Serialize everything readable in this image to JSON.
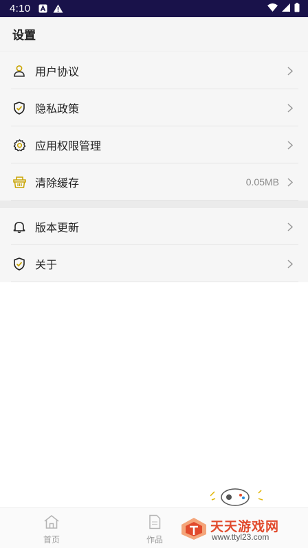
{
  "status_bar": {
    "time": "4:10",
    "icons": [
      "a-notification-icon",
      "warning-icon",
      "wifi-icon",
      "cellular-icon",
      "battery-icon"
    ]
  },
  "header": {
    "title": "设置"
  },
  "settings": {
    "group1": [
      {
        "label": "用户协议",
        "icon": "user-icon"
      },
      {
        "label": "隐私政策",
        "icon": "shield-check-icon"
      },
      {
        "label": "应用权限管理",
        "icon": "gear-icon"
      },
      {
        "label": "清除缓存",
        "icon": "basket-icon",
        "value": "0.05MB"
      }
    ],
    "group2": [
      {
        "label": "版本更新",
        "icon": "bell-icon"
      },
      {
        "label": "关于",
        "icon": "shield-check-icon"
      }
    ]
  },
  "bottom_nav": {
    "items": [
      {
        "label": "首页",
        "icon": "home-icon"
      },
      {
        "label": "作品",
        "icon": "document-gif-icon"
      }
    ]
  },
  "watermark": {
    "brand": "天天游戏网",
    "url": "www.ttyl23.com"
  },
  "colors": {
    "status_bar_bg": "#19124a",
    "accent": "#c9a400",
    "watermark": "#e14a2c"
  }
}
